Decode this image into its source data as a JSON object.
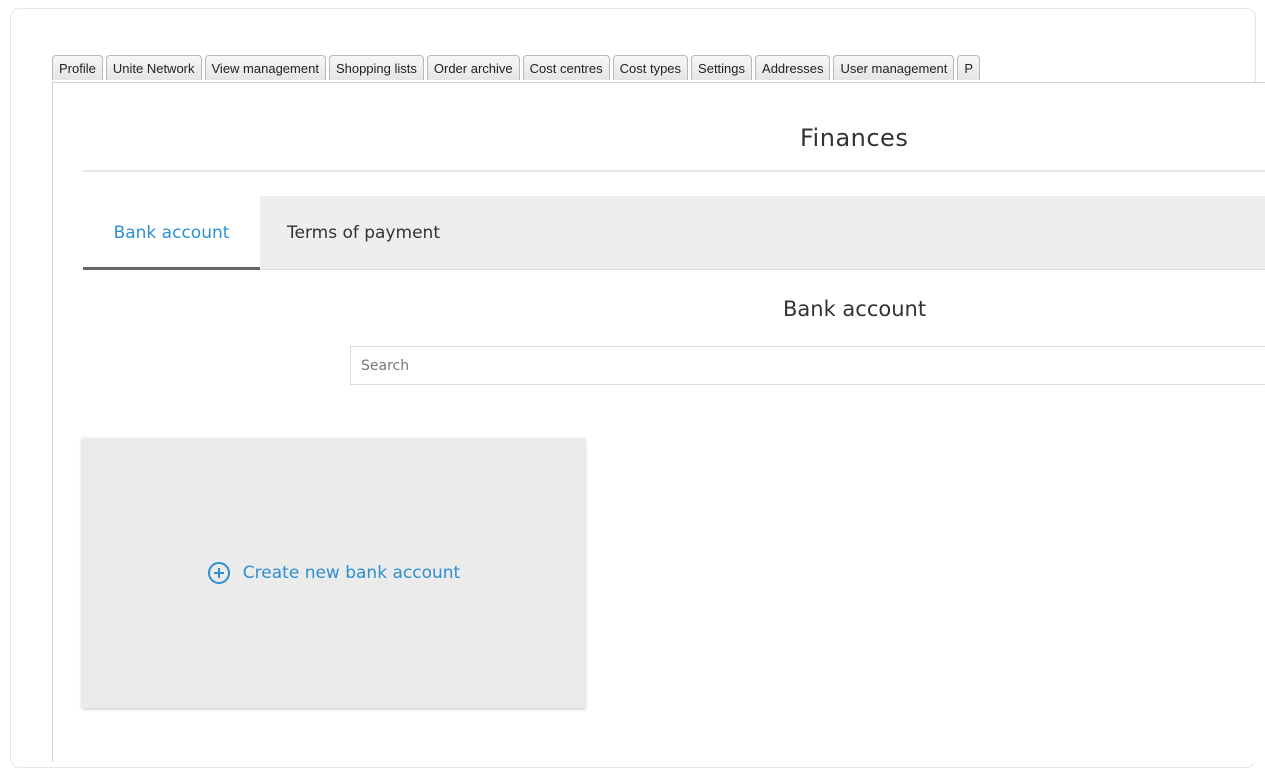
{
  "browser_tabs": [
    {
      "label": "Profile"
    },
    {
      "label": "Unite Network"
    },
    {
      "label": "View management"
    },
    {
      "label": "Shopping lists"
    },
    {
      "label": "Order archive"
    },
    {
      "label": "Cost centres"
    },
    {
      "label": "Cost types"
    },
    {
      "label": "Settings"
    },
    {
      "label": "Addresses"
    },
    {
      "label": "User management"
    },
    {
      "label": "P"
    }
  ],
  "page": {
    "title": "Finances"
  },
  "subtabs": {
    "active_label": "Bank account",
    "inactive_label": "Terms of payment"
  },
  "section": {
    "title": "Bank account"
  },
  "search": {
    "placeholder": "Search",
    "value": ""
  },
  "create_card": {
    "label": "Create new bank account",
    "icon": "plus-circle-icon"
  },
  "colors": {
    "accent": "#2d8fd0",
    "subtab_bar": "#eeeeee",
    "card_bg": "#ebebeb"
  }
}
